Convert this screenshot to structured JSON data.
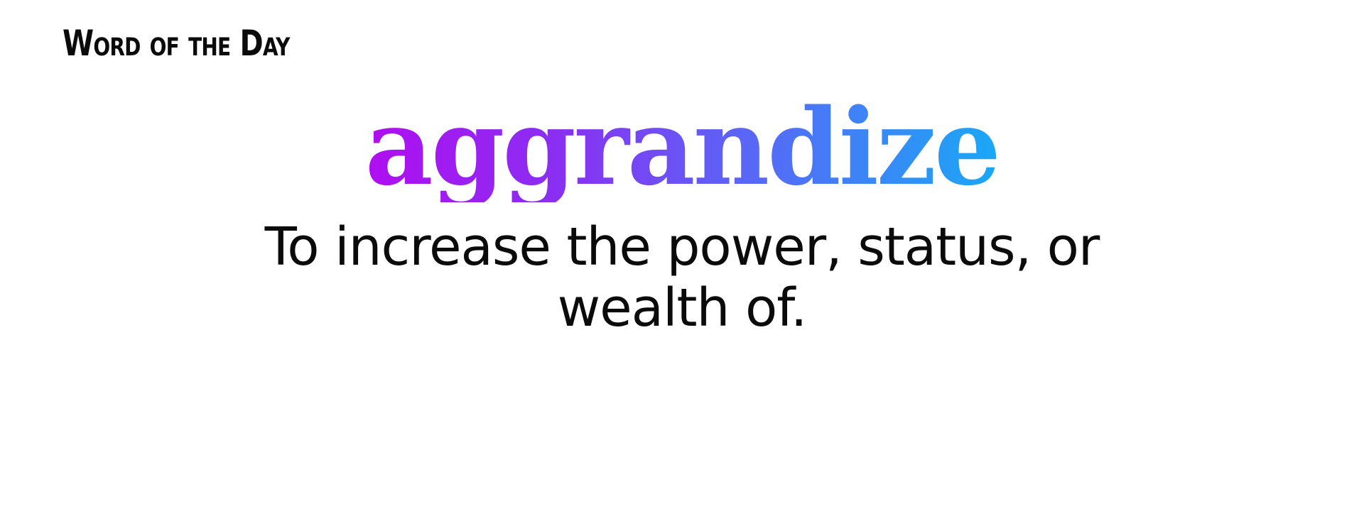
{
  "header": {
    "label": "Word of the Day"
  },
  "entry": {
    "word": "aggrandize",
    "definition": "To increase the power, status, or wealth of."
  },
  "colors": {
    "gradient_start": "#b00ef0",
    "gradient_mid": "#5a66f6",
    "gradient_end": "#1aa8f6",
    "text": "#0b0b0b",
    "background": "#ffffff"
  }
}
